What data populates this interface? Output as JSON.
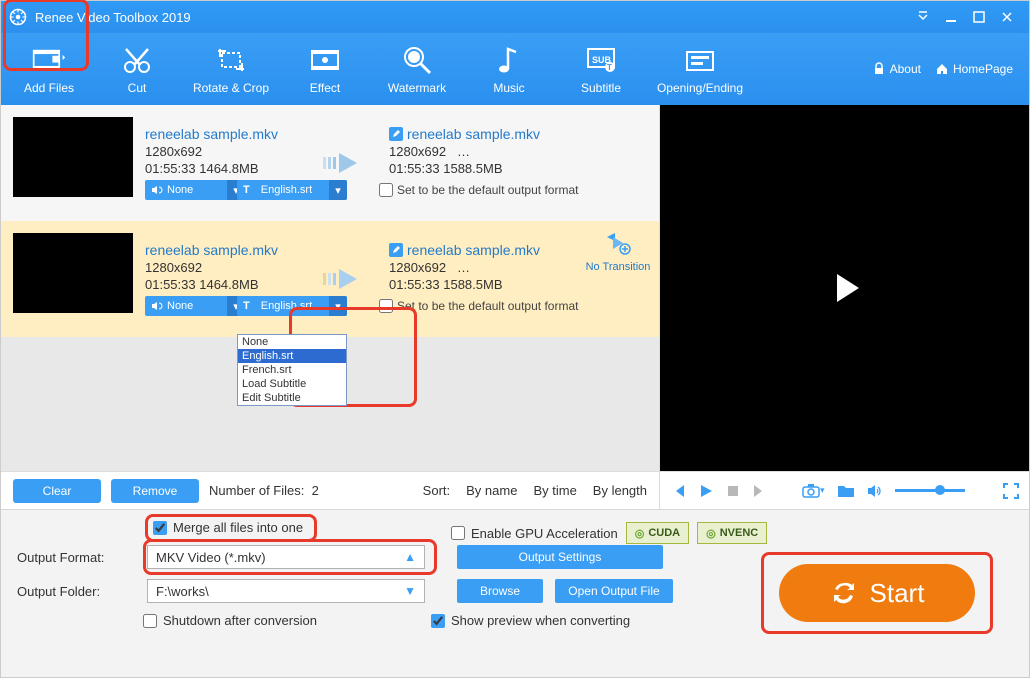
{
  "title": "Renee Video Toolbox 2019",
  "toolbar": {
    "add_files": "Add Files",
    "cut": "Cut",
    "rotate_crop": "Rotate & Crop",
    "effect": "Effect",
    "watermark": "Watermark",
    "music": "Music",
    "subtitle": "Subtitle",
    "opening_ending": "Opening/Ending",
    "about": "About",
    "homepage": "HomePage"
  },
  "files": [
    {
      "name": "reneelab sample.mkv",
      "resolution": "1280x692",
      "duration": "01:55:33",
      "size": "1464.8MB",
      "out_name": "reneelab sample.mkv",
      "out_resolution": "1280x692",
      "out_more": "…",
      "out_duration": "01:55:33",
      "out_size": "1588.5MB",
      "audio_dd": "None",
      "sub_dd": "English.srt",
      "default_label": "Set to be the default output format"
    },
    {
      "name": "reneelab sample.mkv",
      "resolution": "1280x692",
      "duration": "01:55:33",
      "size": "1464.8MB",
      "out_name": "reneelab sample.mkv",
      "out_resolution": "1280x692",
      "out_more": "…",
      "out_duration": "01:55:33",
      "out_size": "1588.5MB",
      "audio_dd": "None",
      "sub_dd": "English.srt",
      "default_label": "Set to be the default output format",
      "transition": "No Transition"
    }
  ],
  "sub_dropdown_options": [
    "None",
    "English.srt",
    "French.srt",
    "Load Subtitle",
    "Edit Subtitle"
  ],
  "list_footer": {
    "clear": "Clear",
    "remove": "Remove",
    "count_label": "Number of Files:",
    "count_value": "2",
    "sort_label": "Sort:",
    "by_name": "By name",
    "by_time": "By time",
    "by_length": "By length"
  },
  "bottom": {
    "merge": "Merge all files into one",
    "enable_gpu": "Enable GPU Acceleration",
    "cuda": "CUDA",
    "nvenc": "NVENC",
    "output_format_label": "Output Format:",
    "output_format_value": "MKV Video (*.mkv)",
    "output_settings": "Output Settings",
    "output_folder_label": "Output Folder:",
    "output_folder_value": "F:\\works\\",
    "browse": "Browse",
    "open_output_file": "Open Output File",
    "shutdown": "Shutdown after conversion",
    "show_preview": "Show preview when converting",
    "start": "Start"
  }
}
